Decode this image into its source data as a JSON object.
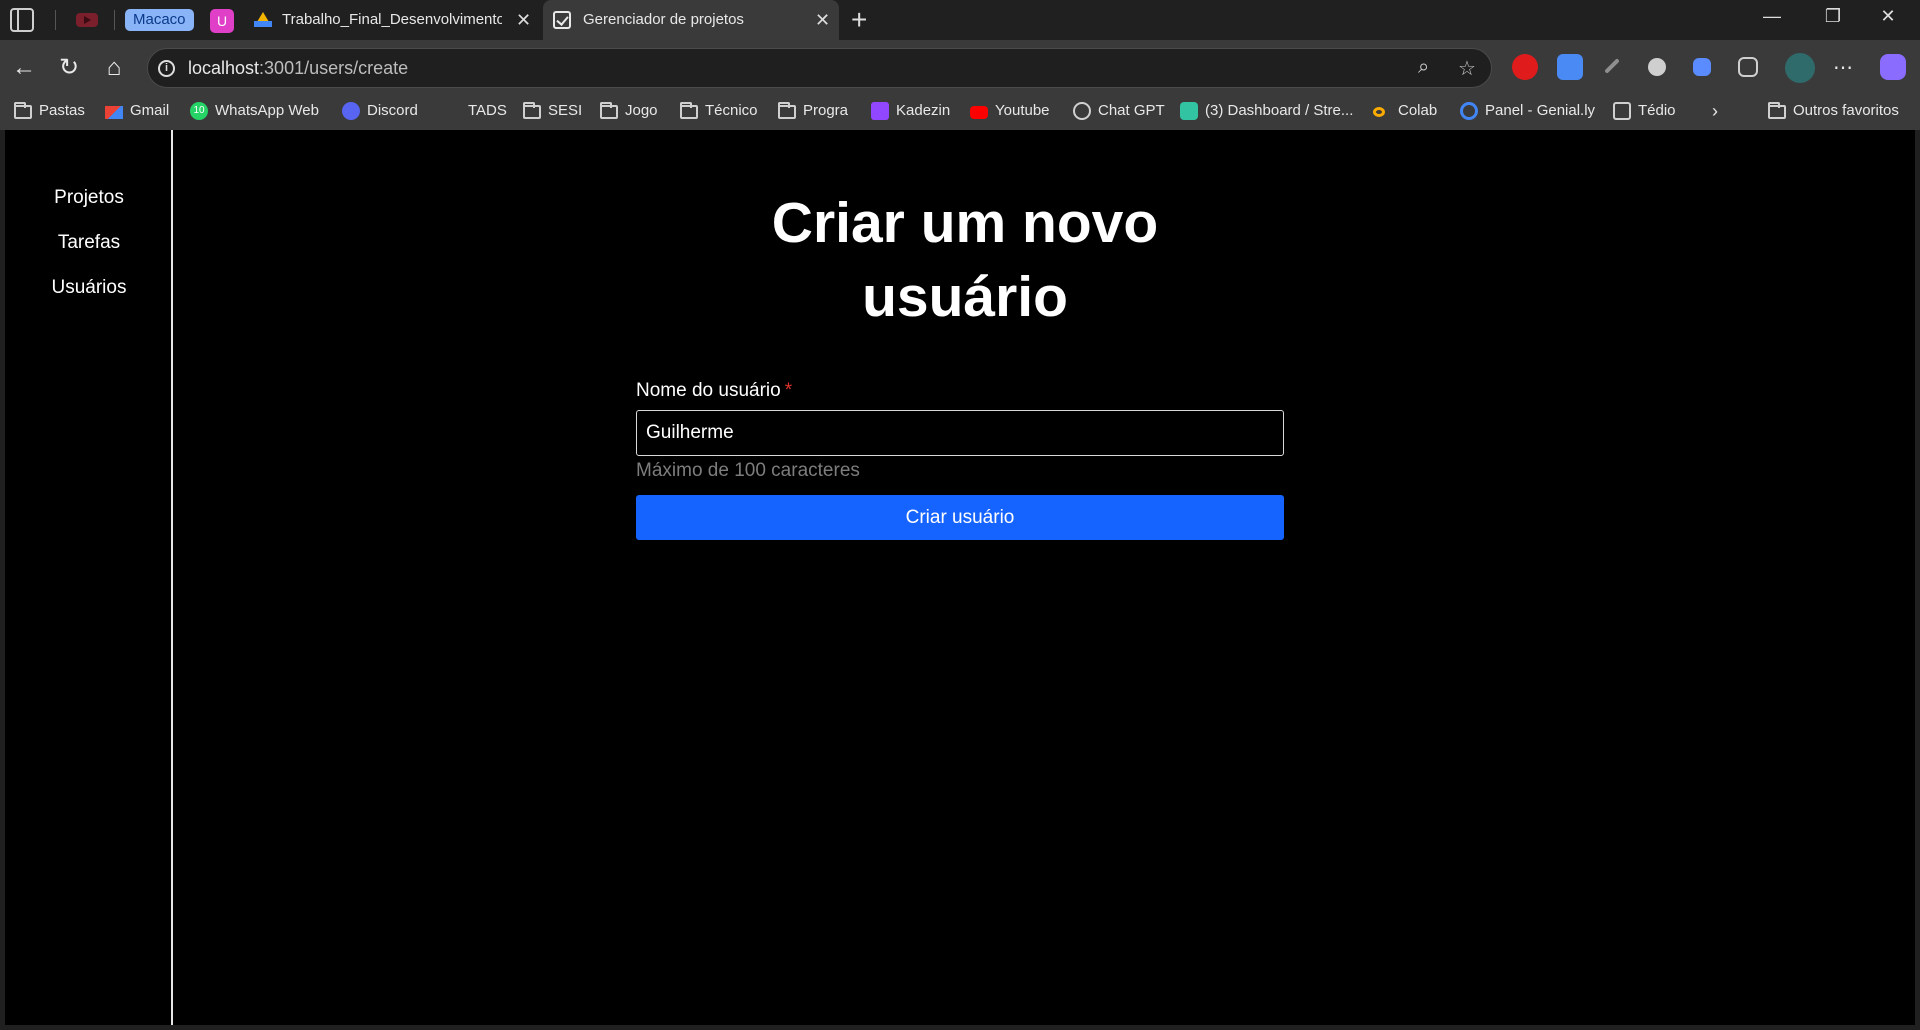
{
  "browser": {
    "tabs": {
      "group_label": "Macaco",
      "group_u_label": "U",
      "tab1_title": "Trabalho_Final_Desenvolvimento_",
      "tab2_title": "Gerenciador de projetos"
    },
    "window_controls": {
      "minimize": "—",
      "maximize": "❐",
      "close": "✕"
    },
    "address": {
      "host": "localhost",
      "rest": ":3001/users/create"
    },
    "bookmarks": [
      {
        "label": "Pastas",
        "icon": "folder-icon"
      },
      {
        "label": "Gmail",
        "icon": "gmail-icon"
      },
      {
        "label": "WhatsApp Web",
        "icon": "whatsapp-icon",
        "badge": "10"
      },
      {
        "label": "Discord",
        "icon": "discord-icon"
      },
      {
        "label": "TADS",
        "icon": "none"
      },
      {
        "label": "SESI",
        "icon": "folder-icon"
      },
      {
        "label": "Jogo",
        "icon": "folder-icon"
      },
      {
        "label": "Técnico",
        "icon": "folder-icon"
      },
      {
        "label": "Progra",
        "icon": "folder-icon"
      },
      {
        "label": "Kadezin",
        "icon": "twitch-icon"
      },
      {
        "label": "Youtube",
        "icon": "youtube-icon"
      },
      {
        "label": "Chat GPT",
        "icon": "chatgpt-icon"
      },
      {
        "label": "(3) Dashboard / Stre...",
        "icon": "streamlabs-icon"
      },
      {
        "label": "Colab",
        "icon": "colab-icon"
      },
      {
        "label": "Panel - Genial.ly",
        "icon": "genially-icon"
      },
      {
        "label": "Tédio",
        "icon": "notion-icon"
      }
    ],
    "other_favorites": "Outros favoritos"
  },
  "sidebar": {
    "items": [
      {
        "label": "Projetos"
      },
      {
        "label": "Tarefas"
      },
      {
        "label": "Usuários"
      }
    ]
  },
  "page": {
    "title_line1": "Criar um novo",
    "title_line2": "usuário",
    "form": {
      "name_label": "Nome do usuário",
      "required_mark": "*",
      "name_value": "Guilherme",
      "hint": "Máximo de 100 caracteres",
      "submit_label": "Criar usuário"
    }
  },
  "colors": {
    "accent": "#1664ff",
    "required": "#e0342d",
    "page_bg": "#000000"
  }
}
